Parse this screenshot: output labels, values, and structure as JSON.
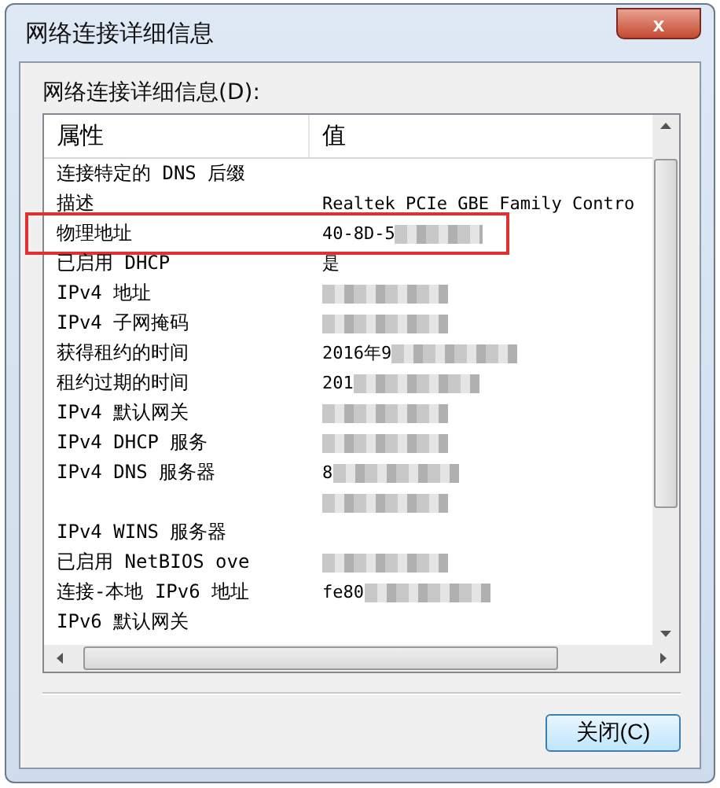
{
  "window": {
    "title": "网络连接详细信息",
    "close": "x"
  },
  "details": {
    "label": "网络连接详细信息(D):",
    "columns": [
      "属性",
      "值"
    ],
    "rows": [
      {
        "property": "连接特定的 DNS 后缀",
        "redacted": false,
        "highlighted": false
      },
      {
        "property": "描述",
        "value": "Realtek PCIe GBE Family Contro",
        "redacted": false,
        "highlighted": false
      },
      {
        "property": "物理地址",
        "value": "40-8D-5",
        "redacted": true,
        "highlighted": true
      },
      {
        "property": "已启用 DHCP",
        "value": "是",
        "redacted": false,
        "highlighted": false
      },
      {
        "property": "IPv4 地址",
        "redacted": true,
        "highlighted": false
      },
      {
        "property": "IPv4 子网掩码",
        "redacted": true,
        "highlighted": false
      },
      {
        "property": "获得租约的时间",
        "value": "2016年9",
        "redacted": true,
        "highlighted": false
      },
      {
        "property": "租约过期的时间",
        "value": "201",
        "redacted": true,
        "highlighted": false
      },
      {
        "property": "IPv4 默认网关",
        "redacted": true,
        "highlighted": false
      },
      {
        "property": "IPv4 DHCP 服务",
        "redacted": true,
        "highlighted": false
      },
      {
        "property": "IPv4 DNS 服务器",
        "value": "8",
        "redacted": true,
        "highlighted": false
      },
      {
        "redacted": true,
        "highlighted": false
      },
      {
        "property": "IPv4 WINS 服务器",
        "redacted": false,
        "highlighted": false
      },
      {
        "property": "已启用 NetBIOS ove",
        "redacted": true,
        "highlighted": false
      },
      {
        "property": "连接-本地 IPv6 地址",
        "value": "fe80",
        "redacted": true,
        "highlighted": false
      },
      {
        "property": "IPv6 默认网关",
        "redacted": false,
        "highlighted": false
      }
    ]
  },
  "buttons": [
    "关闭(C)"
  ]
}
